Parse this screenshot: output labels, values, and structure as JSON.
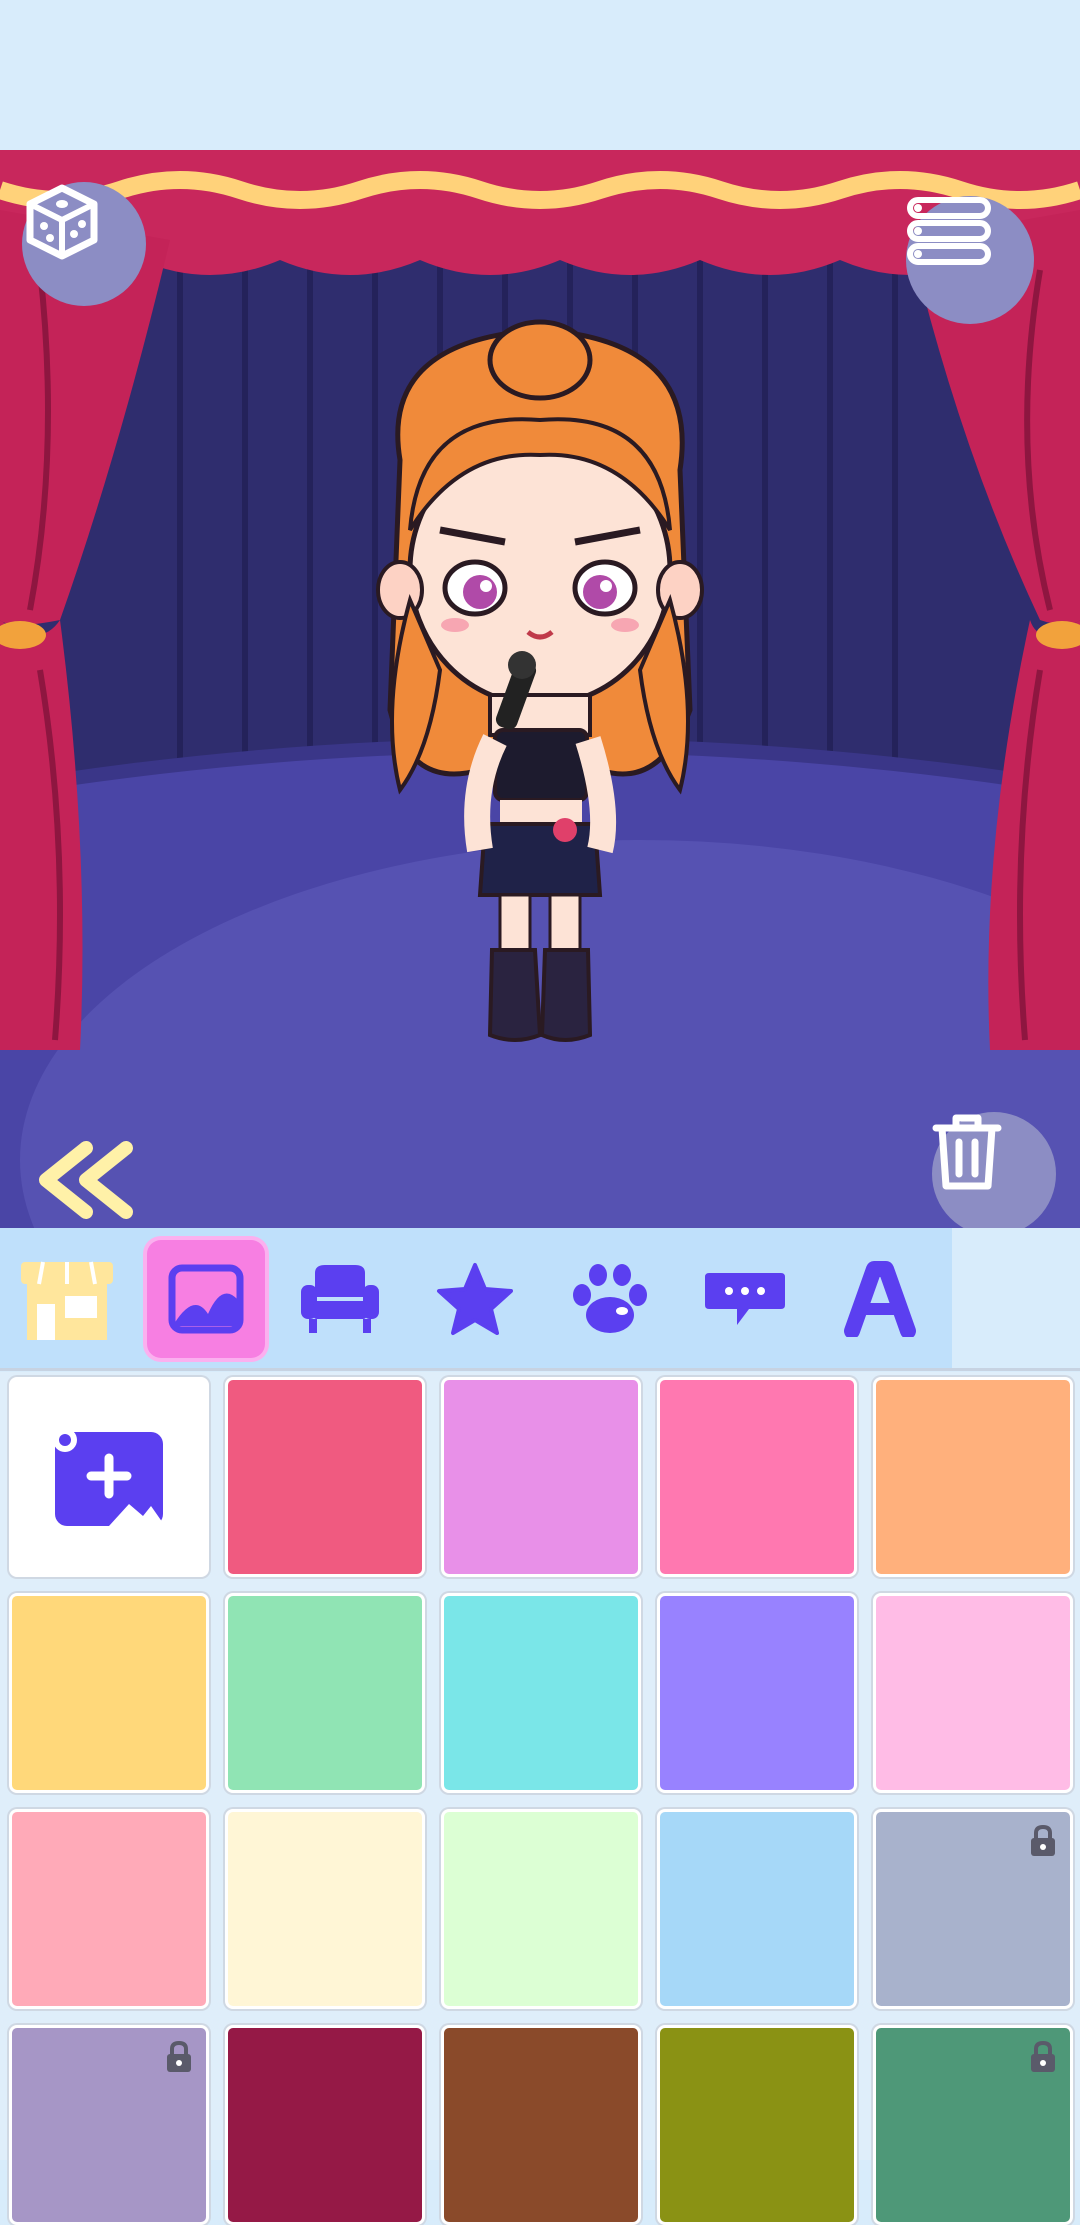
{
  "header": {
    "blank": ""
  },
  "stage": {
    "randomize_icon": "dice-icon",
    "menu_icon": "list-menu-icon",
    "back_icon": "double-chevron-left-icon",
    "delete_icon": "trash-icon"
  },
  "tabs": [
    {
      "name": "tab-shop",
      "icon": "storefront-icon",
      "active": false
    },
    {
      "name": "tab-background",
      "icon": "landscape-image-icon",
      "active": true
    },
    {
      "name": "tab-furniture",
      "icon": "armchair-icon",
      "active": false
    },
    {
      "name": "tab-stickers",
      "icon": "star-icon",
      "active": false
    },
    {
      "name": "tab-pets",
      "icon": "paw-icon",
      "active": false
    },
    {
      "name": "tab-speech",
      "icon": "speech-bubble-icon",
      "active": false
    },
    {
      "name": "tab-text",
      "icon": "letter-a-icon",
      "active": false
    }
  ],
  "grid": {
    "add_icon": "add-image-icon",
    "colors": [
      {
        "hex": "#f05a80",
        "locked": false
      },
      {
        "hex": "#e890e8",
        "locked": false
      },
      {
        "hex": "#ff78b0",
        "locked": false
      },
      {
        "hex": "#ffb07c",
        "locked": false
      },
      {
        "hex": "#ffd87a",
        "locked": false
      },
      {
        "hex": "#90e4b4",
        "locked": false
      },
      {
        "hex": "#7ae6e8",
        "locked": false
      },
      {
        "hex": "#9882ff",
        "locked": false
      },
      {
        "hex": "#ffbce6",
        "locked": false
      },
      {
        "hex": "#ffaab8",
        "locked": false
      },
      {
        "hex": "#fff6d6",
        "locked": false
      },
      {
        "hex": "#dcffd4",
        "locked": false
      },
      {
        "hex": "#a6d8f8",
        "locked": false
      },
      {
        "hex": "#a8b2cc",
        "locked": true
      },
      {
        "hex": "#a696c6",
        "locked": true
      },
      {
        "hex": "#951946",
        "locked": false
      },
      {
        "hex": "#8a4a2a",
        "locked": false
      },
      {
        "hex": "#8a9214",
        "locked": false
      },
      {
        "hex": "#4e9878",
        "locked": true
      }
    ]
  }
}
